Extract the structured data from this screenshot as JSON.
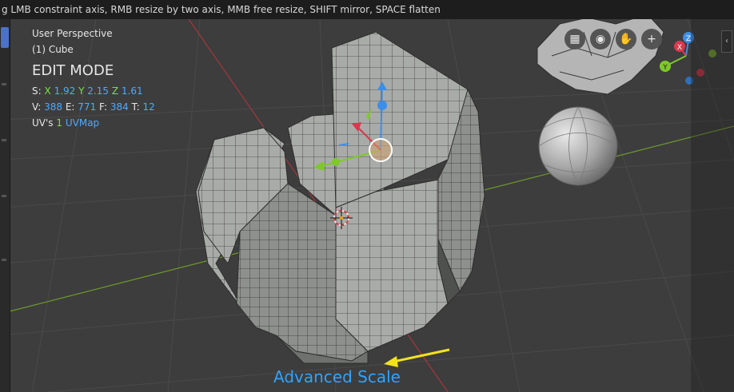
{
  "header": {
    "status_text": "g LMB constraint axis, RMB resize by two axis, MMB free resize, SHIFT mirror, SPACE flatten"
  },
  "viewport": {
    "view_name": "User Perspective",
    "object_name": "(1) Cube",
    "mode": "EDIT MODE",
    "scale": {
      "label": "S:",
      "x_label": "X",
      "x_value": "1.92",
      "y_label": "Y",
      "y_value": "2.15",
      "z_label": "Z",
      "z_value": "1.61"
    },
    "stats": {
      "v_label": "V:",
      "v_value": "388",
      "e_label": "E:",
      "e_value": "771",
      "f_label": "F:",
      "f_value": "384",
      "t_label": "T:",
      "t_value": "12"
    },
    "uv": {
      "label": "UV's",
      "count": "1",
      "name": "UVMap"
    }
  },
  "nav_gizmo": {
    "x_label": "X",
    "y_label": "Y",
    "z_label": "Z",
    "icons": [
      "grid-icon",
      "camera-icon",
      "hand-icon",
      "zoom-icon"
    ],
    "glyphs": [
      "▦",
      "◉",
      "✋",
      "+"
    ]
  },
  "caption": {
    "text": "Advanced Scale",
    "color": "#2fa3ff"
  },
  "colors": {
    "x_axis": "#d9384e",
    "y_axis": "#7ec82a",
    "z_axis": "#3d8ee8",
    "annotation_arrow": "#f2e21c"
  }
}
